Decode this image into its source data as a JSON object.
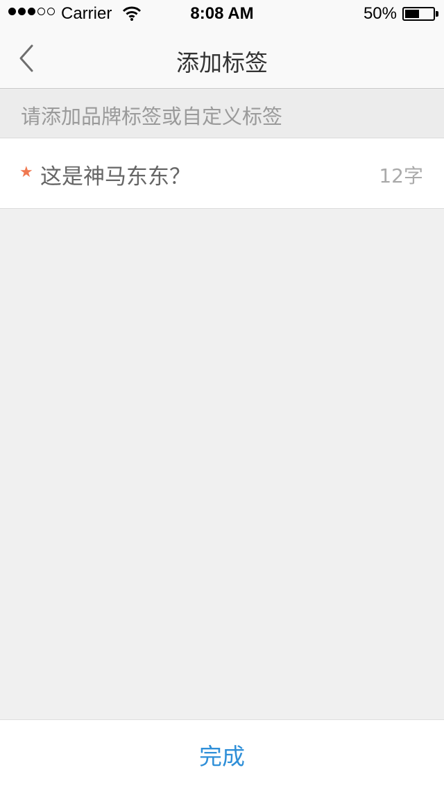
{
  "status_bar": {
    "carrier": "Carrier",
    "time": "8:08 AM",
    "battery_text": "50%",
    "battery_level": 0.5,
    "signal_filled": 3,
    "signal_total": 5
  },
  "nav": {
    "title": "添加标签",
    "back_icon": "chevron-left-icon"
  },
  "hint": "请添加品牌标签或自定义标签",
  "tag_field": {
    "value": "这是神马东东？",
    "counter": "12字",
    "required_icon": "star-icon"
  },
  "footer": {
    "done_label": "完成"
  },
  "colors": {
    "accent": "#2f8fd8",
    "star": "#f07850",
    "background": "#f0f0f0"
  }
}
